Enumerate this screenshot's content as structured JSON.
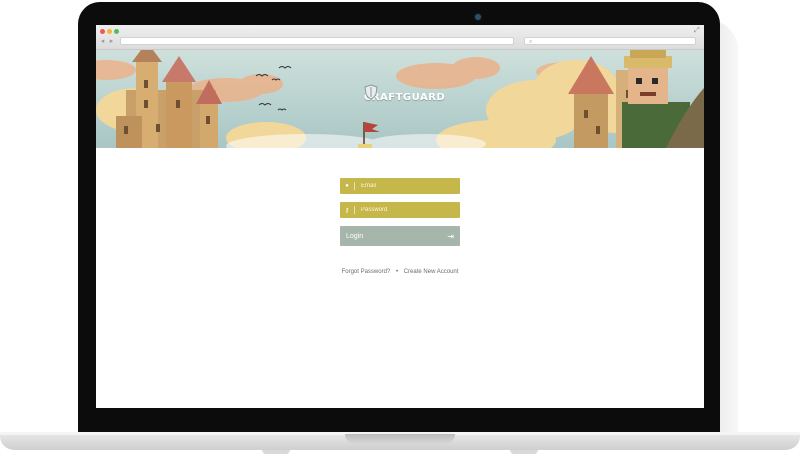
{
  "browser": {
    "back_icon": "back-arrow-icon",
    "forward_icon": "forward-arrow-icon",
    "url": "",
    "search_placeholder": "",
    "traffic_lights": [
      "#f0574f",
      "#f4b43a",
      "#4fc14f"
    ]
  },
  "banner": {
    "logo_text": "CRAFTGUARD",
    "logo_icon": "shield-logo-icon"
  },
  "login": {
    "email_placeholder": "Email",
    "email_icon": "user-icon",
    "password_placeholder": "Password",
    "password_icon": "key-icon",
    "login_label": "Login",
    "login_icon": "sign-in-icon",
    "forgot_label": "Forgot Password?",
    "separator": "•",
    "create_label": "Create New Account"
  },
  "colors": {
    "field_bg": "#c6b74a",
    "button_bg": "#a6b6ab",
    "laptop_bezel": "#0c0c0c"
  }
}
